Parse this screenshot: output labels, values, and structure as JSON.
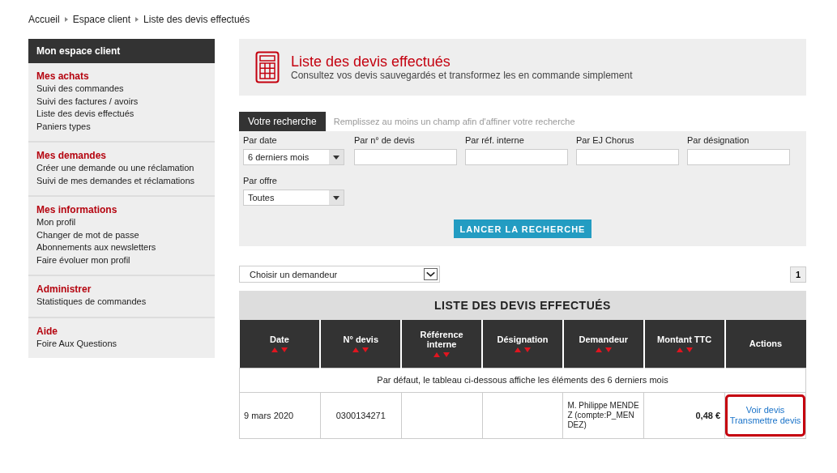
{
  "breadcrumb": [
    "Accueil",
    "Espace client",
    "Liste des devis effectués"
  ],
  "sidebar": {
    "title": "Mon espace client",
    "sections": [
      {
        "heading": "Mes achats",
        "items": [
          "Suivi des commandes",
          "Suivi des factures / avoirs",
          "Liste des devis effectués",
          "Paniers types"
        ]
      },
      {
        "heading": "Mes demandes",
        "items": [
          "Créer une demande ou une réclamation",
          "Suivi de mes demandes et réclamations"
        ]
      },
      {
        "heading": "Mes informations",
        "items": [
          "Mon profil",
          "Changer de mot de passe",
          "Abonnements aux newsletters",
          "Faire évoluer mon profil"
        ]
      },
      {
        "heading": "Administrer",
        "items": [
          "Statistiques de commandes"
        ]
      },
      {
        "heading": "Aide",
        "items": [
          "Foire Aux Questions"
        ]
      }
    ]
  },
  "header": {
    "title": "Liste des devis effectués",
    "subtitle": "Consultez vos devis sauvegardés et transformez les en commande simplement"
  },
  "search": {
    "tab": "Votre recherche",
    "hint": "Remplissez au moins un champ afin d'affiner votre recherche",
    "fields": [
      {
        "kind": "select",
        "label": "Par date",
        "value": "6 derniers mois"
      },
      {
        "kind": "text",
        "label": "Par n° de devis"
      },
      {
        "kind": "text",
        "label": "Par réf. interne"
      },
      {
        "kind": "text",
        "label": "Par EJ Chorus"
      },
      {
        "kind": "text",
        "label": "Par désignation"
      },
      {
        "kind": "select",
        "label": "Par offre",
        "value": "Toutes"
      }
    ],
    "button": "LANCER LA RECHERCHE"
  },
  "requester_select": "Choisir un demandeur",
  "pages": [
    {
      "label": "1",
      "selected": true
    }
  ],
  "table": {
    "title": "LISTE DES DEVIS EFFECTUÉS",
    "columns": [
      {
        "label": "Date",
        "sortable": true
      },
      {
        "label": "N° devis",
        "sortable": true
      },
      {
        "label": "Référence interne",
        "sortable": true
      },
      {
        "label": "Désignation",
        "sortable": true
      },
      {
        "label": "Demandeur",
        "sortable": true
      },
      {
        "label": "Montant TTC",
        "sortable": true
      },
      {
        "label": "Actions",
        "sortable": false
      }
    ],
    "notice": "Par défaut, le tableau ci-dessous affiche les éléments des 6 derniers mois",
    "rows": [
      {
        "date": "9 mars 2020",
        "number": "0300134271",
        "requester": "M. Philippe MENDEZ (compte:P_MENDEZ)",
        "amount": "0,48 €",
        "actions": [
          "Voir devis",
          "Transmettre devis"
        ],
        "highlighted": true
      }
    ]
  }
}
